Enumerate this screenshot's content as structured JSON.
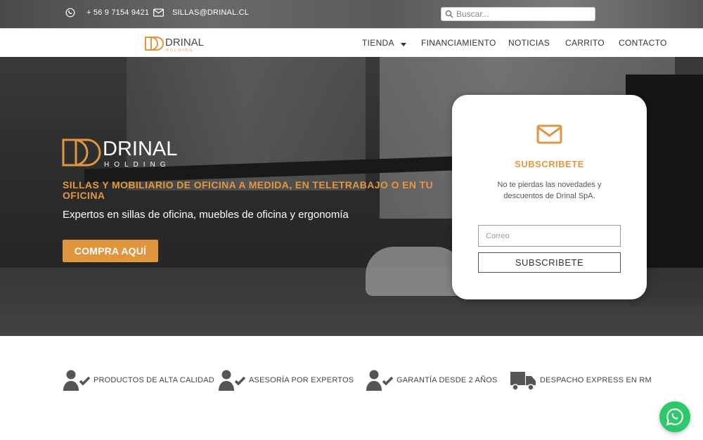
{
  "topbar": {
    "phone": "+ 56 9 7154 9421",
    "email": "SILLAS@DRINAL.CL",
    "search_placeholder": "Buscar..."
  },
  "brand": {
    "name": "DRINAL",
    "sub": "HOLDING",
    "accent": "#e2953f"
  },
  "nav": {
    "items": [
      {
        "label": "TIENDA"
      },
      {
        "label": "FINANCIAMIENTO"
      },
      {
        "label": "NOTICIAS"
      },
      {
        "label": "CARRITO"
      },
      {
        "label": "CONTACTO"
      }
    ]
  },
  "hero": {
    "title": "SILLAS Y MOBILIARIO DE OFICINA A MEDIDA, EN TELETRABAJO O EN TU OFICINA",
    "subtitle": "Expertos en sillas de oficina, muebles de oficina y ergonomía",
    "cta": "COMPRA AQUÍ"
  },
  "subscribe": {
    "title": "SUBSCRIBETE",
    "description": "No te pierdas las novedades y descuentos de Drinal SpA.",
    "email_placeholder": "Correo",
    "button": "SUBSCRIBETE"
  },
  "features": [
    {
      "label": "PRODUCTOS DE ALTA CALIDAD",
      "icon": "user-check-icon"
    },
    {
      "label": "ASESORÍA POR EXPERTOS",
      "icon": "user-check-icon"
    },
    {
      "label": "GARANTÍA DESDE 2 AÑOS",
      "icon": "user-check-icon"
    },
    {
      "label": "DESPACHO EXPRESS EN RM",
      "icon": "truck-icon"
    }
  ],
  "whatsapp": {
    "icon": "whatsapp-icon",
    "color": "#2dc86a"
  }
}
